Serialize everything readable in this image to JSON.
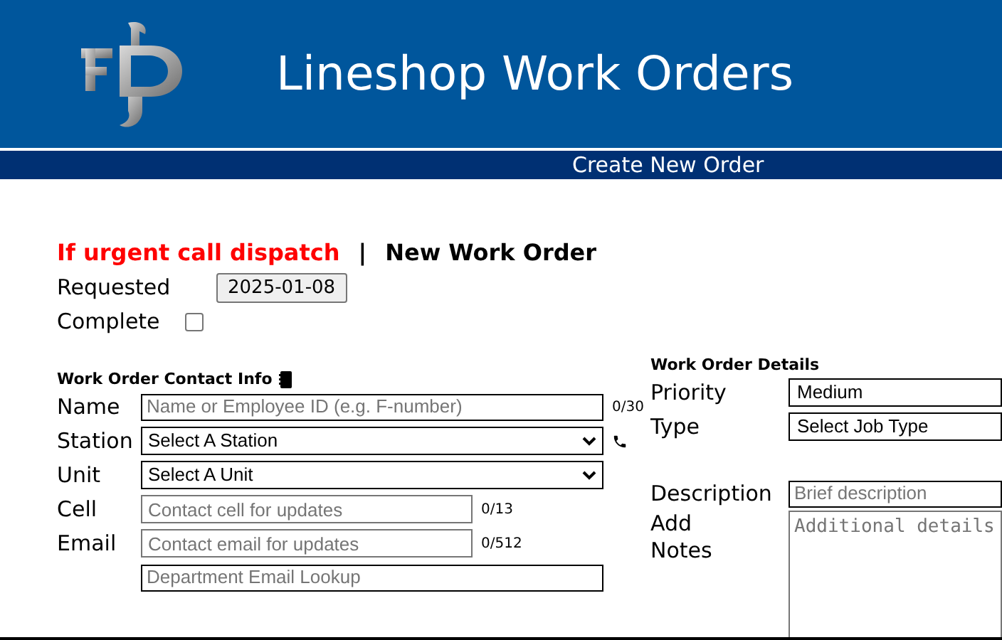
{
  "header": {
    "title": "Lineshop Work Orders",
    "subtitle": "Create New Order"
  },
  "heading": {
    "urgent": "If urgent call dispatch",
    "separator": "|",
    "title": "New Work Order"
  },
  "requested": {
    "label": "Requested",
    "value": "2025-01-08"
  },
  "complete": {
    "label": "Complete",
    "checked": false
  },
  "contact": {
    "title": "Work Order Contact Info",
    "fields": [
      {
        "kind": "text",
        "label": "Name",
        "placeholder": "Name or Employee ID (e.g. F-number)",
        "counter": "0/30",
        "call_button": false
      },
      {
        "kind": "select",
        "label": "Station",
        "value": "Select A Station",
        "call_button": true
      },
      {
        "kind": "select",
        "label": "Unit",
        "value": "Select A Unit",
        "call_button": false
      },
      {
        "kind": "short",
        "label": "Cell",
        "placeholder": "Contact cell for updates",
        "counter": "0/13",
        "call_button": false
      },
      {
        "kind": "short",
        "label": "Email",
        "placeholder": "Contact email for updates",
        "counter": "0/512",
        "call_button": false
      },
      {
        "kind": "text",
        "placeholder": "Department Email Lookup",
        "call_button": false
      }
    ]
  },
  "details": {
    "title": "Work Order Details",
    "priority": {
      "label": "Priority",
      "value": "Medium"
    },
    "type": {
      "label": "Type",
      "value": "Select Job Type"
    },
    "description": {
      "label": "Description",
      "placeholder": "Brief description"
    },
    "notes": {
      "label": "Add Notes",
      "placeholder": "Additional details"
    }
  }
}
